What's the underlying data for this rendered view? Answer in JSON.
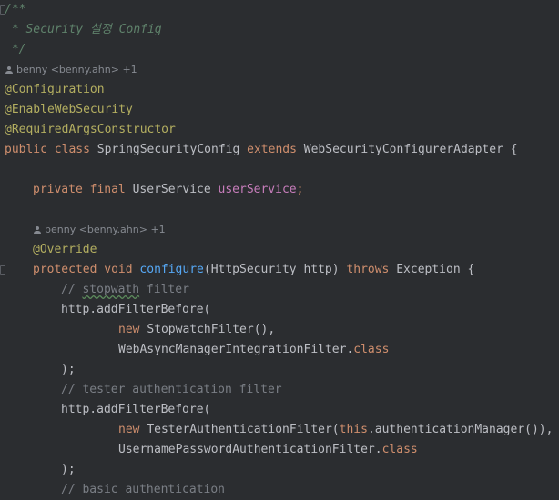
{
  "code": {
    "doc_open": "/**",
    "doc_text": " * Security 설정 Config",
    "doc_close": " */",
    "author_hint_1": "benny <benny.ahn> +1",
    "annotation_configuration": "@Configuration",
    "annotation_enable_web_security": "@EnableWebSecurity",
    "annotation_required_args": "@RequiredArgsConstructor",
    "kw_public": "public",
    "kw_class": "class",
    "class_name": "SpringSecurityConfig",
    "kw_extends": "extends",
    "parent_class": "WebSecurityConfigurerAdapter",
    "open_brace": "{",
    "kw_private": "private",
    "kw_final": "final",
    "field_type": "UserService",
    "field_name": "userService",
    "semicolon": ";",
    "author_hint_2": "benny <benny.ahn> +1",
    "annotation_override": "@Override",
    "kw_protected": "protected",
    "kw_void": "void",
    "method_name": "configure",
    "method_params": "(HttpSecurity http)",
    "kw_throws": "throws",
    "exception_type": "Exception",
    "comment_slashes_1": "// ",
    "comment_typo_word": "stopwath",
    "comment_rest_1": " filter",
    "http_add_filter_1": "http.addFilterBefore(",
    "kw_new_1": "new",
    "stopwatch_filter": "StopwatchFilter(),",
    "async_filter": "WebAsyncManagerIntegrationFilter.",
    "kw_class_ref_1": "class",
    "close_paren_1": ");",
    "comment_2": "// tester authentication filter",
    "http_add_filter_2": "http.addFilterBefore(",
    "kw_new_2": "new",
    "tester_filter": "TesterAuthenticationFilter(",
    "kw_this": "this",
    "auth_manager_call": ".authenticationManager()),",
    "username_filter": "UsernamePasswordAuthenticationFilter.",
    "kw_class_ref_2": "class",
    "close_paren_2": ");",
    "comment_3": "// basic authentication"
  },
  "colors": {
    "background": "#2b2d30",
    "keyword": "#cf8e6d",
    "annotation": "#b3ae60",
    "comment": "#7a7e85",
    "doc_comment": "#5f826b",
    "field": "#c77dbb",
    "method_declaration": "#56a8f5",
    "default_text": "#bcbec4"
  },
  "icons": {
    "fold_marker": "fold-marker-icon",
    "author": "user-icon",
    "override_marker": "override-gutter-icon"
  }
}
